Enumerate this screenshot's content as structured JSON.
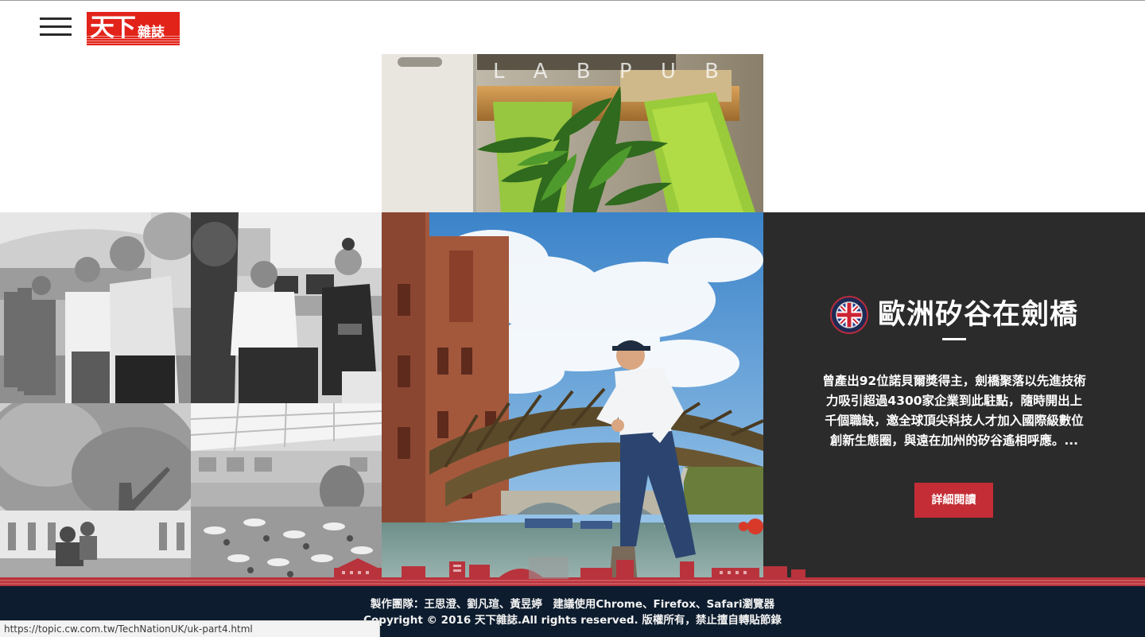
{
  "header": {
    "menu_icon": "hamburger-menu-icon",
    "logo": {
      "text_main": "天下",
      "text_sub": "雜誌",
      "brand_color": "#e2231a"
    }
  },
  "feature": {
    "title": "歐洲矽谷在劍橋",
    "flag_icon": "uk-flag-badge-icon",
    "description": "曾產出92位諾貝爾獎得主，劍橋聚落以先進技術力吸引超過4300家企業到此駐點，隨時開出上千個職缺，邀全球頂尖科技人才加入國際級數位創新生態圈，與遠在加州的矽谷遙相呼應。...",
    "button_label": "詳細閱讀",
    "button_color": "#c42d35",
    "panel_color": "#2b2b2b"
  },
  "photos": {
    "top_photo_text": "L A B  P U B"
  },
  "footer": {
    "credits": "製作團隊：王思澄、劉凡瑄、黃昱婷　建議使用Chrome、Firefox、Safari瀏覽器",
    "copyright": "Copyright © 2016 天下雜誌.All rights reserved. 版權所有，禁止擅自轉貼節錄",
    "background_color": "#0d1c2e"
  },
  "status_bar": {
    "url": "https://topic.cw.com.tw/TechNationUK/uk-part4.html"
  }
}
